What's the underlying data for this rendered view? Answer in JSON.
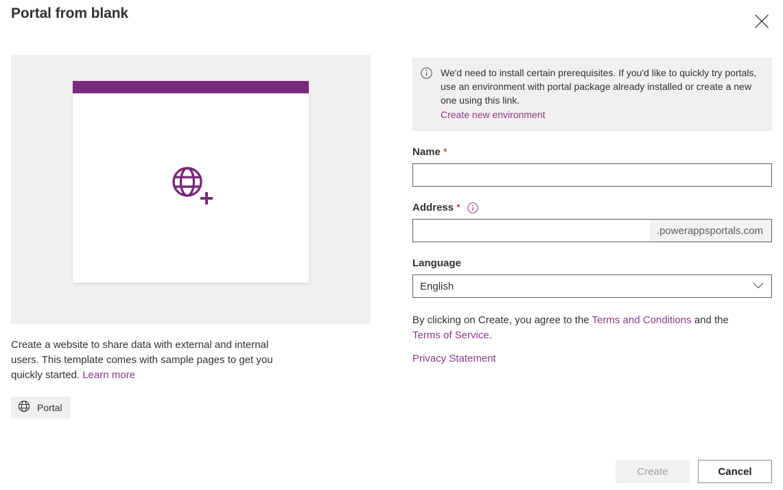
{
  "dialog": {
    "title": "Portal from blank",
    "close_icon": "close-icon"
  },
  "preview": {
    "icon": "globe-plus-icon",
    "accent_color": "#7a2a7c",
    "panel_background": "#f1f0ef"
  },
  "template": {
    "description_part1": "Create a website to share data with external and internal users. This template comes with sample pages to get you quickly started. ",
    "learn_more_label": "Learn more",
    "tag": {
      "icon": "globe-icon",
      "label": "Portal"
    }
  },
  "banner": {
    "icon": "info-circle-icon",
    "message": "We'd need to install certain prerequisites. If you'd like to quickly try portals, use an environment with portal package already installed or create a new one using this link.",
    "link_label": "Create new environment"
  },
  "form": {
    "name": {
      "label": "Name",
      "required_marker": "*",
      "value": "",
      "placeholder": ""
    },
    "address": {
      "label": "Address",
      "required_marker": "*",
      "info_icon": "info-circle-icon",
      "value": "",
      "placeholder": "",
      "suffix": ".powerappsportals.com"
    },
    "language": {
      "label": "Language",
      "selected": "English",
      "chevron_icon": "chevron-down-icon"
    }
  },
  "legal": {
    "text_before": "By clicking on Create, you agree to the ",
    "terms_conditions_label": "Terms and Conditions",
    "text_middle": " and the ",
    "terms_of_service_label": "Terms of Service",
    "text_after": ".",
    "privacy_label": "Privacy Statement"
  },
  "footer": {
    "create_label": "Create",
    "cancel_label": "Cancel"
  },
  "colors": {
    "accent_purple": "#7a2a7c",
    "link_purple": "#8a3a8a",
    "required_red": "#a4262c",
    "neutral_surface": "#f1f0ef",
    "border_gray": "#605e5c"
  }
}
